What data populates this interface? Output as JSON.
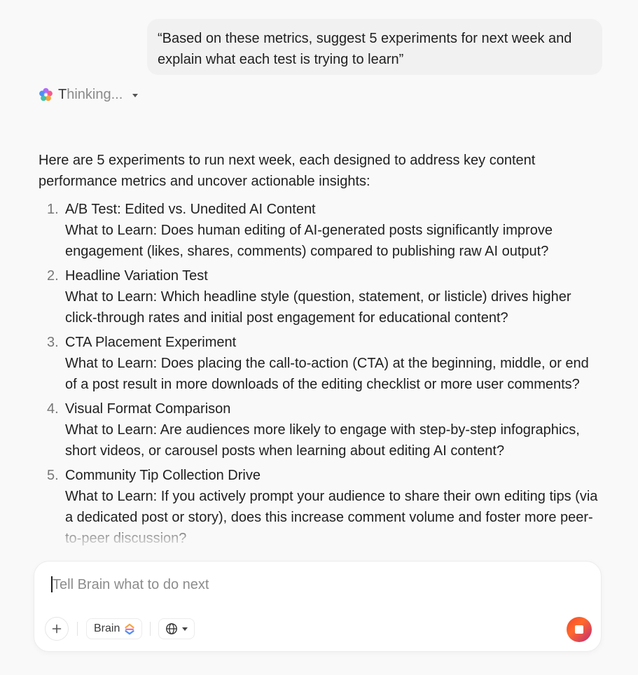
{
  "user_message": "“Based on these metrics, suggest 5 experiments for next week and explain what each test is trying to learn”",
  "thinking": {
    "label_first": "T",
    "label_rest": "hinking..."
  },
  "response": {
    "intro": "Here are 5 experiments to run next week, each designed to address key content performance metrics and uncover actionable insights:",
    "items": [
      {
        "number": "1.",
        "title": "A/B Test: Edited vs. Unedited AI Content",
        "detail": "What to Learn: Does human editing of AI-generated posts significantly improve engagement (likes, shares, comments) compared to publishing raw AI output?"
      },
      {
        "number": "2.",
        "title": "Headline Variation Test",
        "detail": "What to Learn: Which headline style (question, statement, or listicle) drives higher click-through rates and initial post engagement for educational content?"
      },
      {
        "number": "3.",
        "title": "CTA Placement Experiment",
        "detail": "What to Learn: Does placing the call-to-action (CTA) at the beginning, middle, or end of a post result in more downloads of the editing checklist or more user comments?"
      },
      {
        "number": "4.",
        "title": "Visual Format Comparison",
        "detail": "What to Learn: Are audiences more likely to engage with step-by-step infographics, short videos, or carousel posts when learning about editing AI content?"
      },
      {
        "number": "5.",
        "title": "Community Tip Collection Drive",
        "detail": "What to Learn: If you actively prompt your audience to share their own editing tips (via a dedicated post or story), does this increase comment volume and foster more peer-to-peer discussion?"
      }
    ]
  },
  "composer": {
    "placeholder": "Tell Brain what to do next",
    "value": "",
    "brain_label": "Brain"
  },
  "icons": {
    "thinking": "brain-flower-icon",
    "add": "plus-icon",
    "brain_logo": "brain-logo-icon",
    "web": "globe-icon",
    "stop": "stop-icon"
  },
  "colors": {
    "accent_gradient_start": "#f0452e",
    "accent_gradient_end": "#c02a7a",
    "bubble_bg": "#f1f1f2",
    "page_bg": "#f9f9f9"
  }
}
